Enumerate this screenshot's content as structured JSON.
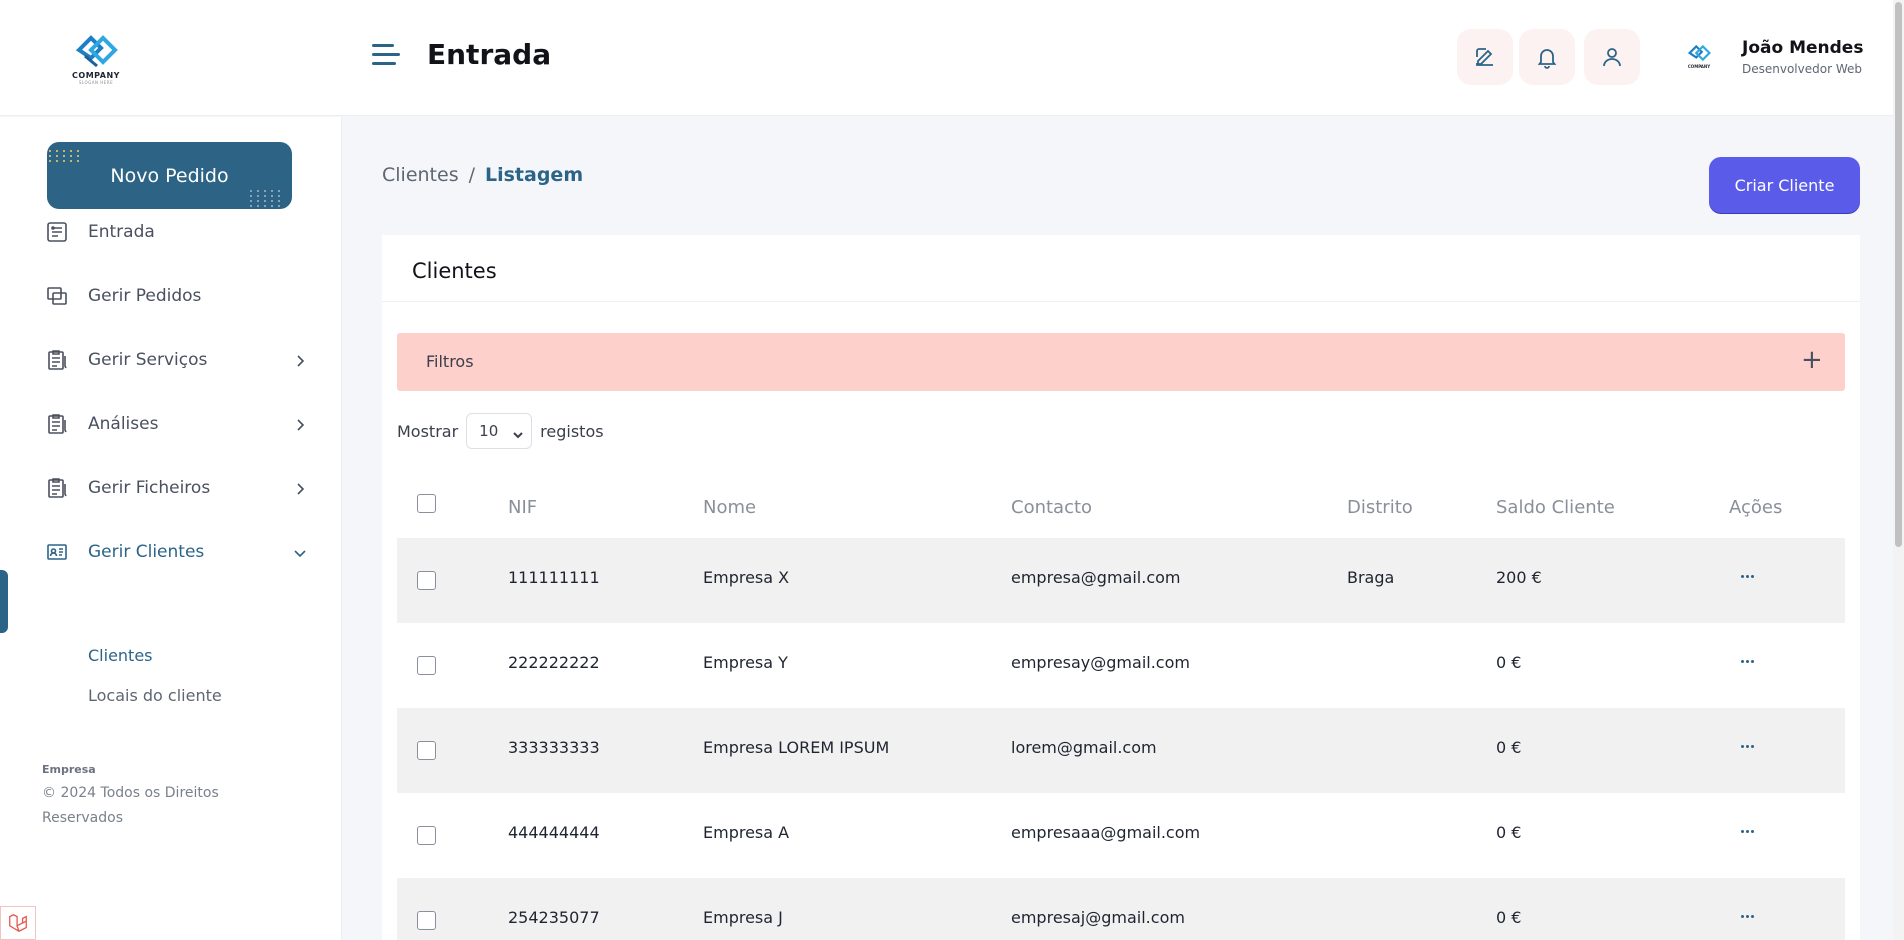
{
  "header": {
    "logo_text": "COMPANY",
    "logo_sub": "SLOGAN HERE",
    "title": "Entrada",
    "icons": [
      "edit-icon",
      "bell-icon",
      "user-icon"
    ],
    "user": {
      "name": "João Mendes",
      "role": "Desenvolvedor Web",
      "avatar_text": "COMPANY"
    }
  },
  "sidebar": {
    "new_order_label": "Novo Pedido",
    "items": [
      {
        "label": "Entrada",
        "icon": "dashboard-icon",
        "has_children": false
      },
      {
        "label": "Gerir Pedidos",
        "icon": "copy-icon",
        "has_children": false
      },
      {
        "label": "Gerir Serviços",
        "icon": "clipboard-icon",
        "has_children": true
      },
      {
        "label": "Análises",
        "icon": "clipboard-icon",
        "has_children": true
      },
      {
        "label": "Gerir Ficheiros",
        "icon": "clipboard-icon",
        "has_children": true
      },
      {
        "label": "Gerir Clientes",
        "icon": "id-card-icon",
        "has_children": true,
        "expanded": true,
        "active": true
      }
    ],
    "subitems": [
      {
        "label": "Clientes",
        "active": true
      },
      {
        "label": "Locais do cliente",
        "active": false
      }
    ],
    "footer_brand": "Empresa",
    "footer_copy": "© 2024 Todos os Direitos Reservados"
  },
  "main": {
    "breadcrumb": {
      "parent": "Clientes",
      "separator": "/",
      "current": "Listagem"
    },
    "create_button": "Criar Cliente",
    "card_title": "Clientes",
    "filters_label": "Filtros",
    "filters_toggle": "+",
    "show": {
      "prefix": "Mostrar",
      "value": "10",
      "suffix": "registos"
    },
    "table": {
      "columns": [
        "NIF",
        "Nome",
        "Contacto",
        "Distrito",
        "Saldo Cliente",
        "Ações"
      ],
      "rows": [
        {
          "nif": "111111111",
          "nome": "Empresa X",
          "contacto": "empresa@gmail.com",
          "distrito": "Braga",
          "saldo": "200 €"
        },
        {
          "nif": "222222222",
          "nome": "Empresa Y",
          "contacto": "empresay@gmail.com",
          "distrito": "",
          "saldo": "0 €"
        },
        {
          "nif": "333333333",
          "nome": "Empresa LOREM IPSUM",
          "contacto": "lorem@gmail.com",
          "distrito": "",
          "saldo": "0 €"
        },
        {
          "nif": "444444444",
          "nome": "Empresa A",
          "contacto": "empresaaa@gmail.com",
          "distrito": "",
          "saldo": "0 €"
        },
        {
          "nif": "254235077",
          "nome": "Empresa J",
          "contacto": "empresaj@gmail.com",
          "distrito": "",
          "saldo": "0 €"
        }
      ]
    }
  },
  "colors": {
    "primary": "#2c6488",
    "accent_button": "#5b5bea",
    "filters_bg": "#fdd0cc",
    "row_alt": "#f1f1f1"
  }
}
